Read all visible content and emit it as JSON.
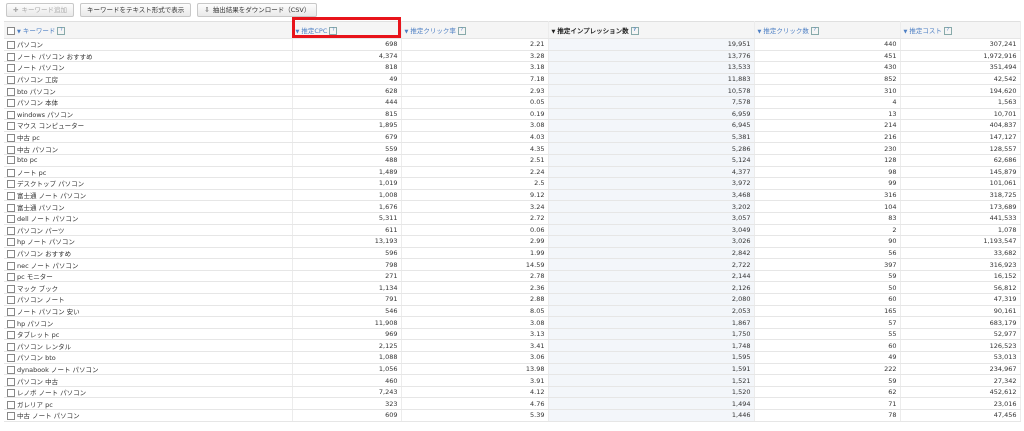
{
  "toolbar": {
    "add_label": "キーワード追加",
    "text_label": "キーワードをテキスト形式で表示",
    "download_label": "抽出結果をダウンロード（CSV）"
  },
  "columns": [
    "キーワード",
    "推定CPC",
    "推定クリック率",
    "推定インプレッション数",
    "推定クリック数",
    "推定コスト"
  ],
  "rows": [
    [
      "パソコン",
      "698",
      "2.21",
      "19,951",
      "440",
      "307,241"
    ],
    [
      "ノート パソコン おすすめ",
      "4,374",
      "3.28",
      "13,776",
      "451",
      "1,972,916"
    ],
    [
      "ノート パソコン",
      "818",
      "3.18",
      "13,533",
      "430",
      "351,494"
    ],
    [
      "パソコン 工房",
      "49",
      "7.18",
      "11,883",
      "852",
      "42,542"
    ],
    [
      "bto パソコン",
      "628",
      "2.93",
      "10,578",
      "310",
      "194,620"
    ],
    [
      "パソコン 本体",
      "444",
      "0.05",
      "7,578",
      "4",
      "1,563"
    ],
    [
      "windows パソコン",
      "815",
      "0.19",
      "6,959",
      "13",
      "10,701"
    ],
    [
      "マウス コンピューター",
      "1,895",
      "3.08",
      "6,945",
      "214",
      "404,837"
    ],
    [
      "中古 pc",
      "679",
      "4.03",
      "5,381",
      "216",
      "147,127"
    ],
    [
      "中古 パソコン",
      "559",
      "4.35",
      "5,286",
      "230",
      "128,557"
    ],
    [
      "bto pc",
      "488",
      "2.51",
      "5,124",
      "128",
      "62,686"
    ],
    [
      "ノート pc",
      "1,489",
      "2.24",
      "4,377",
      "98",
      "145,879"
    ],
    [
      "デスクトップ パソコン",
      "1,019",
      "2.5",
      "3,972",
      "99",
      "101,061"
    ],
    [
      "富士通 ノート パソコン",
      "1,008",
      "9.12",
      "3,468",
      "316",
      "318,725"
    ],
    [
      "富士通 パソコン",
      "1,676",
      "3.24",
      "3,202",
      "104",
      "173,689"
    ],
    [
      "dell ノート パソコン",
      "5,311",
      "2.72",
      "3,057",
      "83",
      "441,533"
    ],
    [
      "パソコン パーツ",
      "611",
      "0.06",
      "3,049",
      "2",
      "1,078"
    ],
    [
      "hp ノート パソコン",
      "13,193",
      "2.99",
      "3,026",
      "90",
      "1,193,547"
    ],
    [
      "パソコン おすすめ",
      "596",
      "1.99",
      "2,842",
      "56",
      "33,682"
    ],
    [
      "nec ノート パソコン",
      "798",
      "14.59",
      "2,722",
      "397",
      "316,923"
    ],
    [
      "pc モニター",
      "271",
      "2.78",
      "2,144",
      "59",
      "16,152"
    ],
    [
      "マック ブック",
      "1,134",
      "2.36",
      "2,126",
      "50",
      "56,812"
    ],
    [
      "パソコン ノート",
      "791",
      "2.88",
      "2,080",
      "60",
      "47,319"
    ],
    [
      "ノート パソコン 安い",
      "546",
      "8.05",
      "2,053",
      "165",
      "90,161"
    ],
    [
      "hp パソコン",
      "11,908",
      "3.08",
      "1,867",
      "57",
      "683,179"
    ],
    [
      "タブレット pc",
      "969",
      "3.13",
      "1,750",
      "55",
      "52,977"
    ],
    [
      "パソコン レンタル",
      "2,125",
      "3.41",
      "1,748",
      "60",
      "126,523"
    ],
    [
      "パソコン bto",
      "1,088",
      "3.06",
      "1,595",
      "49",
      "53,013"
    ],
    [
      "dynabook ノート パソコン",
      "1,056",
      "13.98",
      "1,591",
      "222",
      "234,967"
    ],
    [
      "パソコン 中古",
      "460",
      "3.91",
      "1,521",
      "59",
      "27,342"
    ],
    [
      "レノボ ノート パソコン",
      "7,243",
      "4.12",
      "1,520",
      "62",
      "452,612"
    ],
    [
      "ガレリア pc",
      "323",
      "4.76",
      "1,494",
      "71",
      "23,016"
    ],
    [
      "中古 ノート パソコン",
      "609",
      "5.39",
      "1,446",
      "78",
      "47,456"
    ]
  ]
}
